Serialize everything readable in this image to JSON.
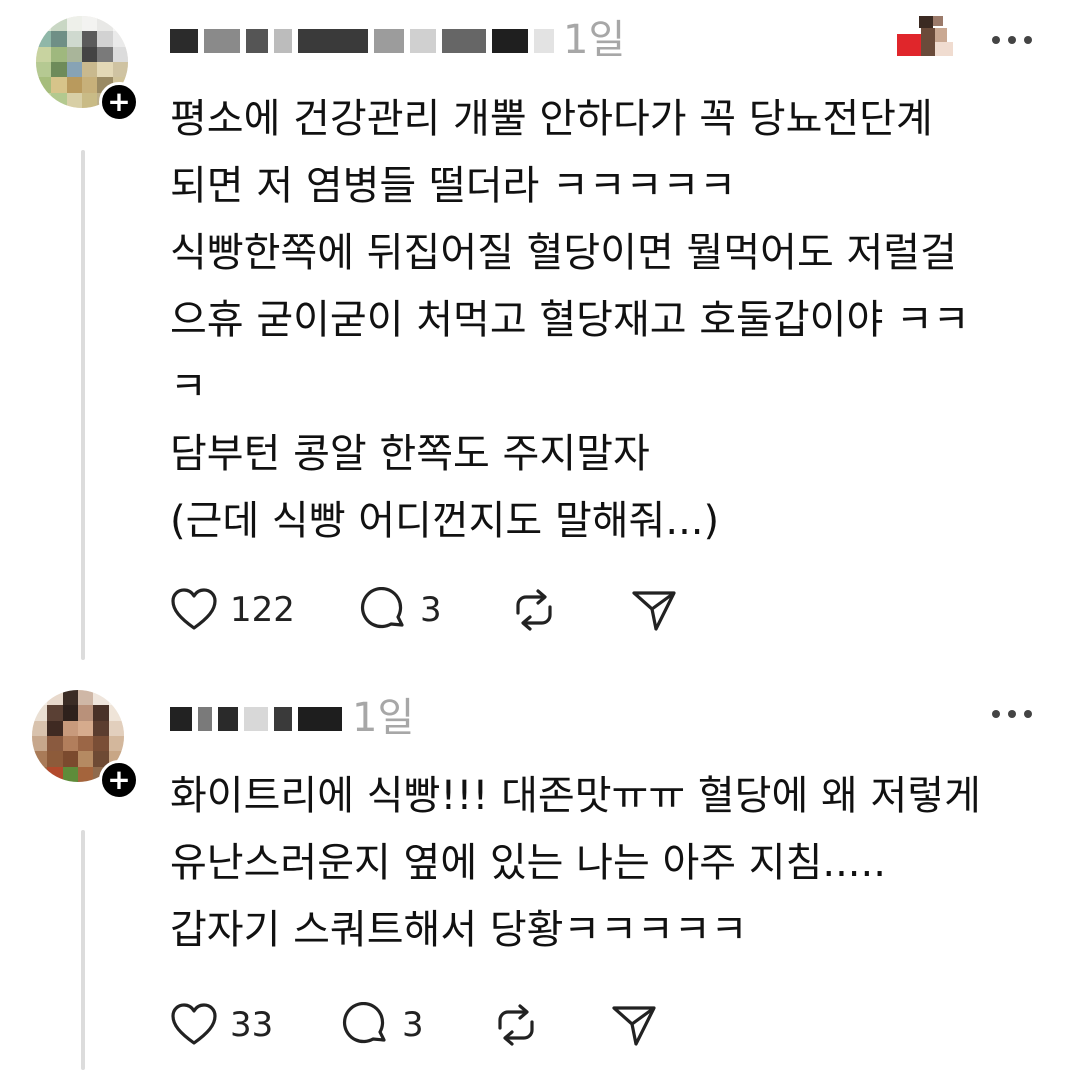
{
  "posts": [
    {
      "timestamp": "1일",
      "text": "평소에 건강관리 개뿔 안하다가 꼭 당뇨전단계\n되면 저 염병들 떨더라 ㅋㅋㅋㅋㅋ\n식빵한쪽에 뒤집어질 혈당이면 뭘먹어도 저럴걸\n으휴 굳이굳이 처먹고 혈당재고 호둘갑이야 ㅋㅋ\nㅋ\n담부턴 콩알 한쪽도 주지말자\n(근데 식빵 어디껀지도 말해줘...)",
      "likes": "122",
      "replies": "3"
    },
    {
      "timestamp": "1일",
      "text": "화이트리에 식빵!!! 대존맛ㅠㅠ 혈당에 왜 저렇게\n유난스러운지 옆에 있는 나는 아주 지침.....\n갑자기 스쿼트해서 당황ㅋㅋㅋㅋㅋ",
      "likes": "33",
      "replies": "3"
    }
  ],
  "icons": {
    "like": "heart-icon",
    "reply": "comment-bubble-icon",
    "repost": "repost-icon",
    "share": "send-icon",
    "more": "more-options-icon",
    "follow": "plus-icon"
  },
  "colors": {
    "text": "#111111",
    "muted": "#a7a7a7",
    "thread_line": "#dcdcdc",
    "badge": "#000000"
  }
}
